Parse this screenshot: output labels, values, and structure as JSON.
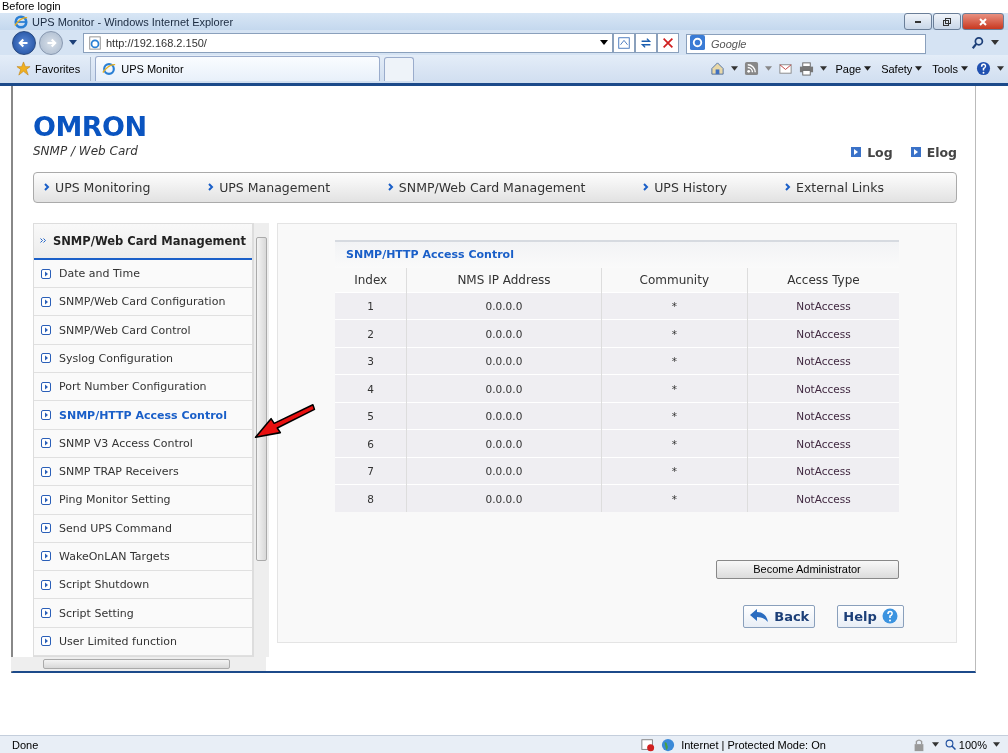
{
  "caption": "Before login",
  "window": {
    "title": "UPS Monitor - Windows Internet Explorer"
  },
  "address_bar": {
    "url": "http://192.168.2.150/"
  },
  "search": {
    "placeholder": "Google"
  },
  "favorites": "Favorites",
  "tabs": [
    {
      "label": "UPS Monitor",
      "selected": true
    }
  ],
  "command_bar": [
    "Page",
    "Safety",
    "Tools"
  ],
  "page": {
    "logo": "OMRON",
    "subtitle": "SNMP / Web Card",
    "header_links": [
      "Log",
      "Elog"
    ],
    "nav": [
      "UPS Monitoring",
      "UPS Management",
      "SNMP/Web Card Management",
      "UPS History",
      "External Links"
    ],
    "sidebar": {
      "title": "SNMP/Web Card Management",
      "items": [
        {
          "label": "Date and Time",
          "selected": false
        },
        {
          "label": "SNMP/Web Card Configuration",
          "selected": false
        },
        {
          "label": "SNMP/Web Card Control",
          "selected": false
        },
        {
          "label": "Syslog Configuration",
          "selected": false
        },
        {
          "label": "Port Number Configuration",
          "selected": false
        },
        {
          "label": "SNMP/HTTP Access Control",
          "selected": true
        },
        {
          "label": "SNMP V3 Access Control",
          "selected": false
        },
        {
          "label": "SNMP TRAP Receivers",
          "selected": false
        },
        {
          "label": "Ping Monitor Setting",
          "selected": false
        },
        {
          "label": "Send UPS Command",
          "selected": false
        },
        {
          "label": "WakeOnLAN Targets",
          "selected": false
        },
        {
          "label": "Script Shutdown",
          "selected": false
        },
        {
          "label": "Script Setting",
          "selected": false
        },
        {
          "label": "User Limited function",
          "selected": false
        }
      ]
    },
    "panel": {
      "title": "SNMP/HTTP Access Control",
      "columns": [
        "Index",
        "NMS IP Address",
        "Community",
        "Access Type"
      ],
      "rows": [
        [
          "1",
          "0.0.0.0",
          "*",
          "NotAccess"
        ],
        [
          "2",
          "0.0.0.0",
          "*",
          "NotAccess"
        ],
        [
          "3",
          "0.0.0.0",
          "*",
          "NotAccess"
        ],
        [
          "4",
          "0.0.0.0",
          "*",
          "NotAccess"
        ],
        [
          "5",
          "0.0.0.0",
          "*",
          "NotAccess"
        ],
        [
          "6",
          "0.0.0.0",
          "*",
          "NotAccess"
        ],
        [
          "7",
          "0.0.0.0",
          "*",
          "NotAccess"
        ],
        [
          "8",
          "0.0.0.0",
          "*",
          "NotAccess"
        ]
      ]
    },
    "admin_button": "Become Administrator",
    "back_button": "Back",
    "help_button": "Help"
  },
  "status_bar": {
    "text": "Done",
    "zone": "Internet | Protected Mode: On",
    "zoom": "100%"
  }
}
